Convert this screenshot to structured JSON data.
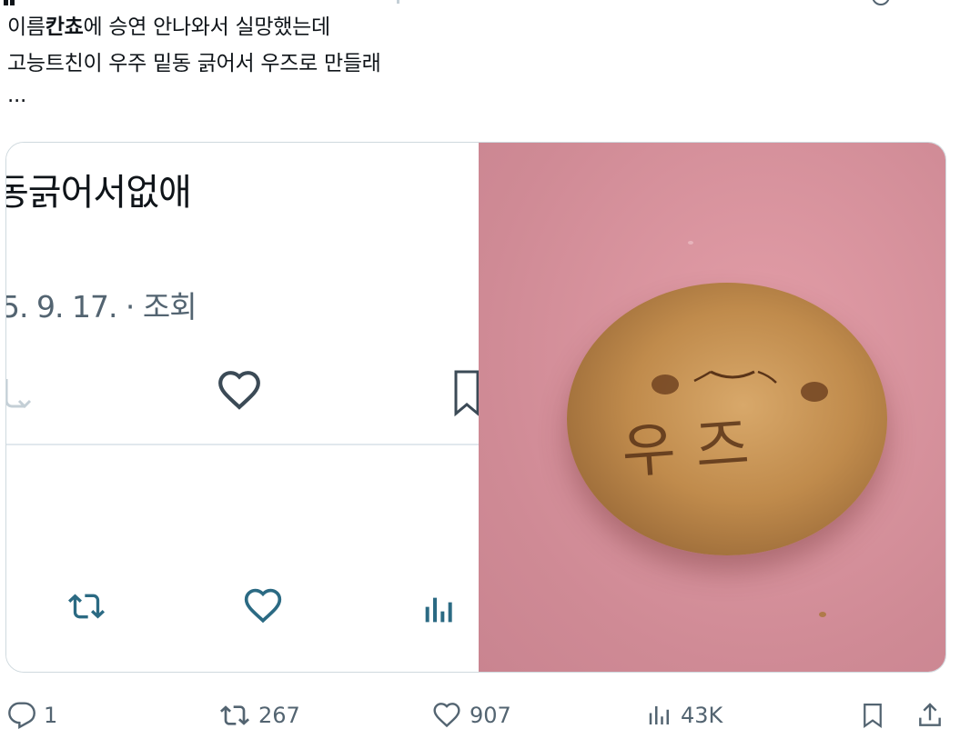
{
  "tweet": {
    "line1_pre": "이름",
    "line1_bold": "칸쵸",
    "line1_post": "에 승연 안나와서 실망했는데",
    "line2": "고능트친이 우주 밑동 긁어서 우즈로 만들래",
    "line3": "..."
  },
  "media": {
    "screenshot": {
      "title": "동긁어서없애",
      "meta": "5. 9. 17. · 조회"
    },
    "photo": {
      "bun_text_top": "•ᴗ•",
      "bun_text_main": "우즈"
    }
  },
  "actions": {
    "reply_count": "1",
    "retweet_count": "267",
    "like_count": "907",
    "views_count": "43K"
  },
  "icons": [
    "reply-icon",
    "retweet-icon",
    "like-icon",
    "views-icon",
    "bookmark-icon",
    "share-icon"
  ],
  "colors": {
    "text": "#0f1419",
    "muted": "#536471",
    "border": "#cfd9de",
    "photo_bg": "#d6909b"
  }
}
